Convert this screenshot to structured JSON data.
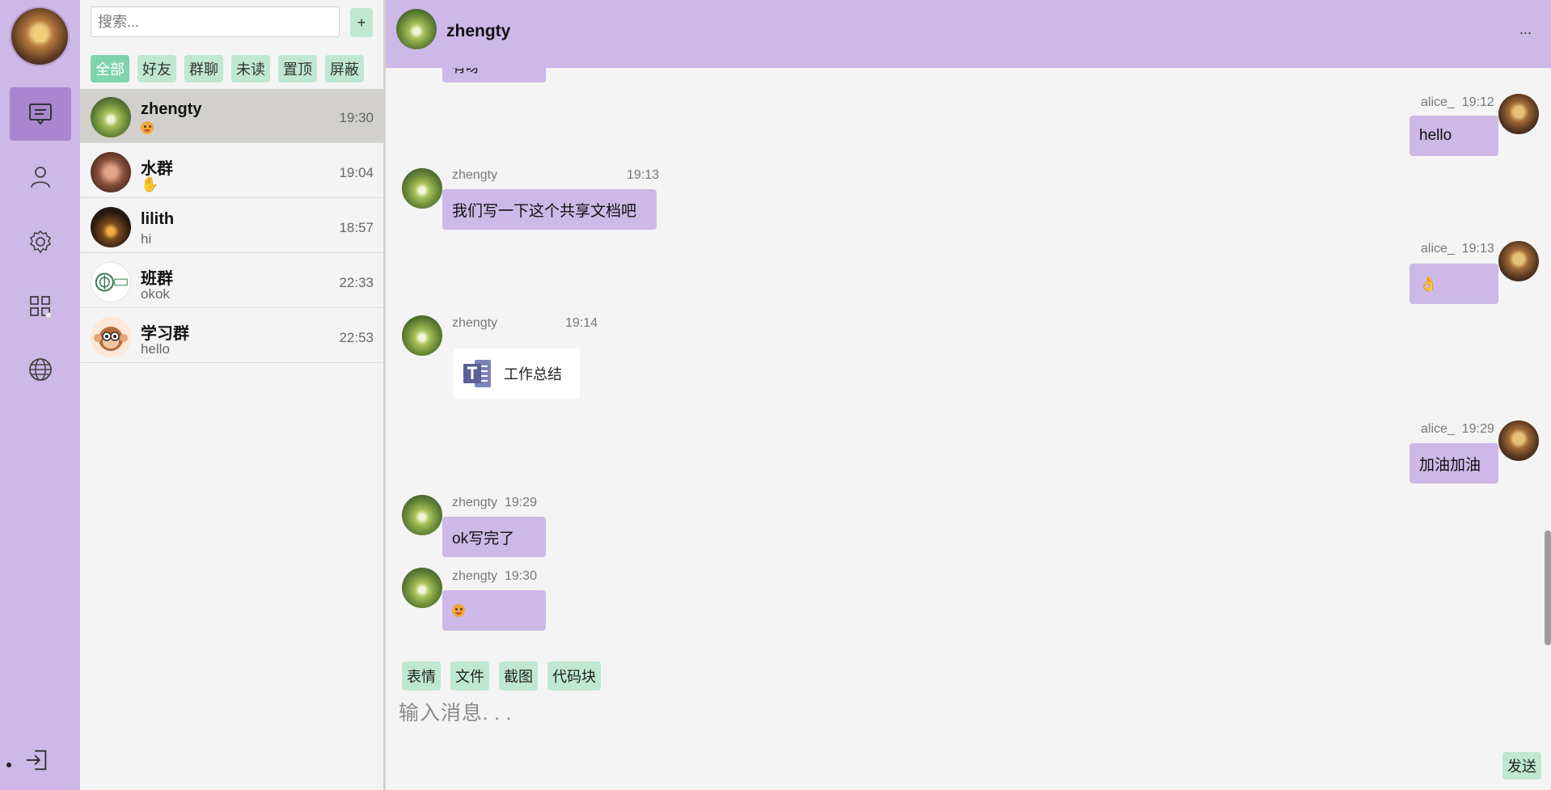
{
  "nav": {
    "items": [
      "messages",
      "contacts",
      "settings",
      "apps",
      "browser"
    ],
    "logout": "logout"
  },
  "search": {
    "placeholder": "搜索...",
    "add_label": "+"
  },
  "filters": [
    "全部",
    "好友",
    "群聊",
    "未读",
    "置顶",
    "屏蔽"
  ],
  "conversations": [
    {
      "name": "zhengty",
      "preview": "",
      "preview_icon": "emoji-face",
      "time": "19:30"
    },
    {
      "name": "水群",
      "preview": "",
      "preview_icon": "emoji-wave",
      "time": "19:04"
    },
    {
      "name": "lilith",
      "preview": "hi",
      "time": "18:57"
    },
    {
      "name": "班群",
      "preview": "okok",
      "time": "22:33"
    },
    {
      "name": "学习群",
      "preview": "hello",
      "time": "22:53"
    }
  ],
  "chat": {
    "title": "zhengty",
    "more": "...",
    "partial_top": "有呀",
    "messages": [
      {
        "user": "alice_",
        "time": "19:12",
        "text": "hello",
        "side": "right"
      },
      {
        "user": "zhengty",
        "time": "19:13",
        "text": "我们写一下这个共享文档吧",
        "side": "left"
      },
      {
        "user": "alice_",
        "time": "19:13",
        "text": "",
        "icon": "emoji-ok",
        "side": "right"
      },
      {
        "user": "zhengty",
        "time": "19:14",
        "file": "工作总结",
        "side": "left"
      },
      {
        "user": "alice_",
        "time": "19:29",
        "text": "加油加油",
        "side": "right"
      },
      {
        "user": "zhengty",
        "time": "19:29",
        "text": "ok写完了",
        "side": "left"
      },
      {
        "user": "zhengty",
        "time": "19:30",
        "text": "",
        "icon": "emoji-face",
        "side": "left"
      }
    ],
    "tools": [
      "表情",
      "文件",
      "截图",
      "代码块"
    ],
    "input_placeholder": "输入消息. . .",
    "send_label": "发送"
  },
  "colors": {
    "accent_purple": "#cdb8e8",
    "active_nav": "#a986cf",
    "chip_green": "#bfe8d3",
    "chip_active": "#7fd3af"
  }
}
